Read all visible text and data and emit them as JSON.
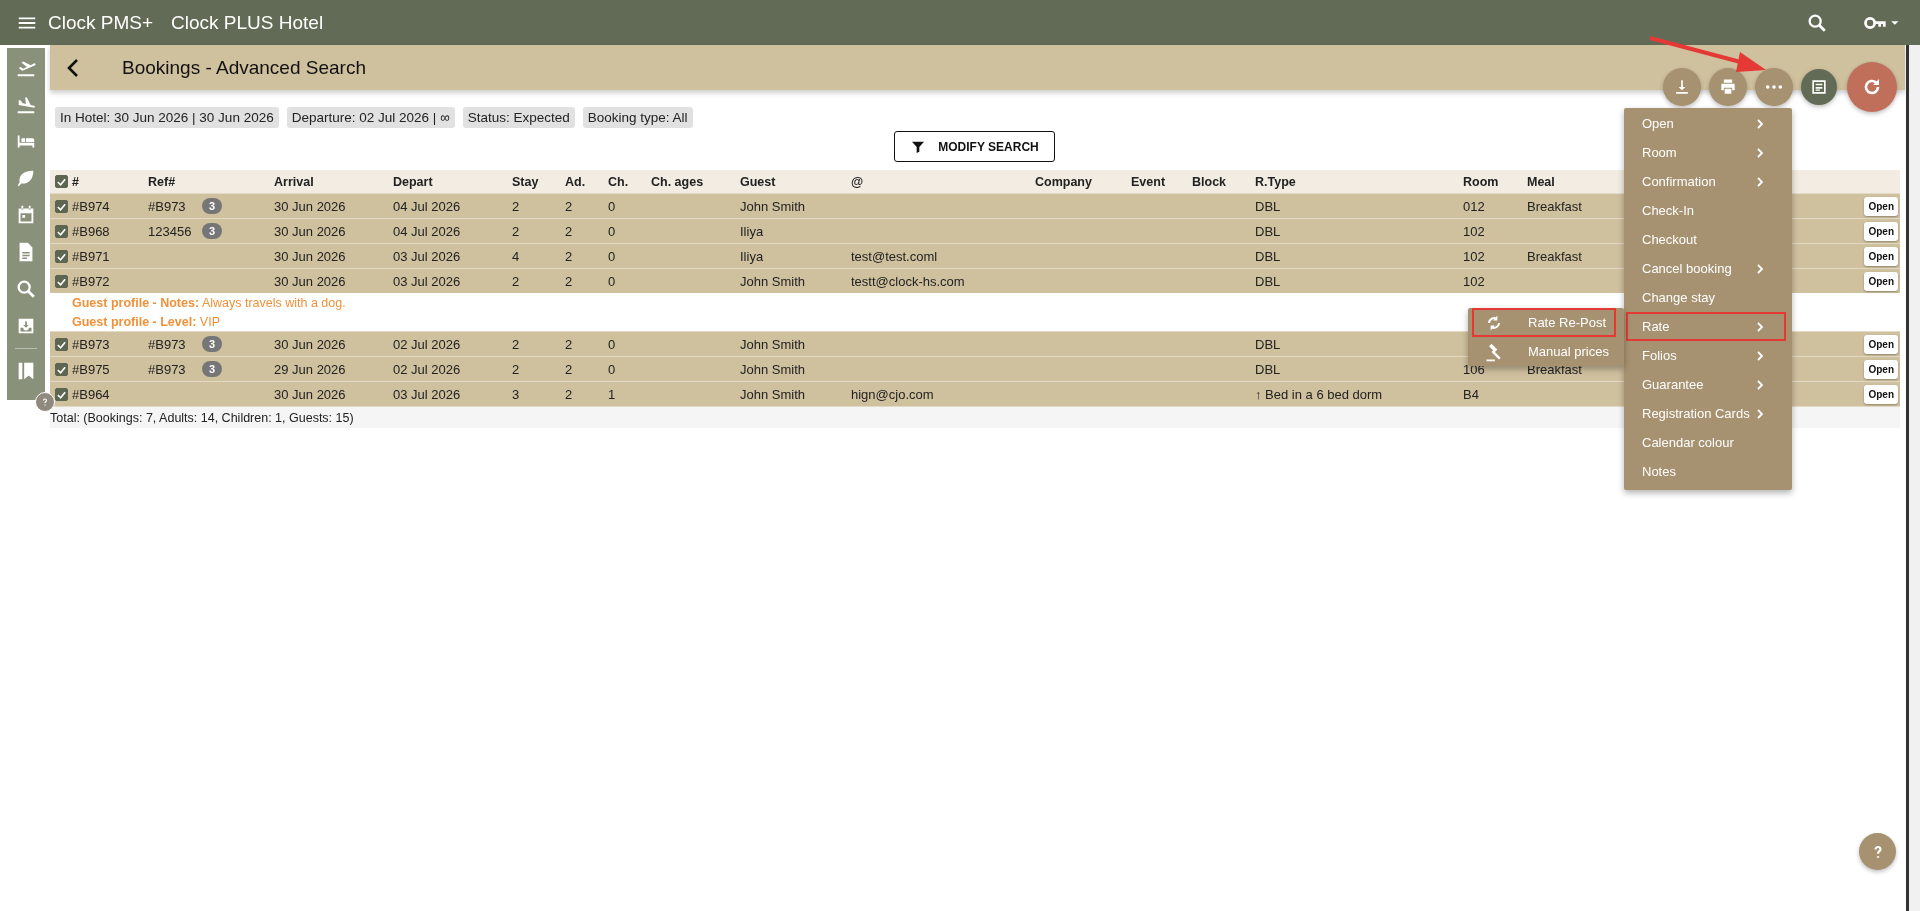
{
  "app_bar": {
    "product": "Clock PMS+",
    "hotel": "Clock PLUS Hotel"
  },
  "page_header": {
    "title": "Bookings - Advanced Search"
  },
  "filters": [
    "In Hotel: 30 Jun 2026 | 30 Jun 2026",
    "Departure: 02 Jul 2026 | ∞",
    "Status: Expected",
    "Booking type: All"
  ],
  "modify_button": "MODIFY SEARCH",
  "table": {
    "select_all": true,
    "columns": [
      "#",
      "Ref#",
      "Arrival",
      "Depart",
      "Stay",
      "Ad.",
      "Ch.",
      "Ch. ages",
      "Guest",
      "@",
      "Company",
      "Event",
      "Block",
      "R.Type",
      "Room",
      "Meal"
    ],
    "rows": [
      {
        "kind": "booking",
        "checked": true,
        "id": "#B974",
        "ref": "#B973",
        "ref_count": "3",
        "arrival": "30 Jun 2026",
        "depart": "04 Jul 2026",
        "stay": "2",
        "adults": "2",
        "children": "0",
        "guest": "John Smith",
        "email": "",
        "rtype": "DBL",
        "room": "012",
        "meal": "Breakfast",
        "action": "Open"
      },
      {
        "kind": "booking",
        "checked": true,
        "id": "#B968",
        "ref": "123456",
        "ref_count": "3",
        "arrival": "30 Jun 2026",
        "depart": "04 Jul 2026",
        "stay": "2",
        "adults": "2",
        "children": "0",
        "guest": "Iliya",
        "email": "",
        "rtype": "DBL",
        "room": "102",
        "meal": "",
        "action": "Open"
      },
      {
        "kind": "booking",
        "checked": true,
        "id": "#B971",
        "ref": "",
        "ref_count": "",
        "arrival": "30 Jun 2026",
        "depart": "03 Jul 2026",
        "stay": "4",
        "adults": "2",
        "children": "0",
        "guest": "Iliya",
        "email": "test@test.coml",
        "rtype": "DBL",
        "room": "102",
        "meal": "Breakfast",
        "action": "Open"
      },
      {
        "kind": "booking",
        "checked": true,
        "id": "#B972",
        "ref": "",
        "ref_count": "",
        "arrival": "30 Jun 2026",
        "depart": "03 Jul 2026",
        "stay": "2",
        "adults": "2",
        "children": "0",
        "guest": "John Smith",
        "email": "testt@clock-hs.com",
        "rtype": "DBL",
        "room": "102",
        "meal": "",
        "action": "Open"
      },
      {
        "kind": "note",
        "text": "**Guest profile - Notes:** Always travels with a dog."
      },
      {
        "kind": "note",
        "text": "**Guest profile - Level:** VIP"
      },
      {
        "kind": "booking",
        "checked": true,
        "id": "#B973",
        "ref": "#B973",
        "ref_count": "3",
        "arrival": "30 Jun 2026",
        "depart": "02 Jul 2026",
        "stay": "2",
        "adults": "2",
        "children": "0",
        "guest": "John Smith",
        "email": "",
        "rtype": "DBL",
        "room": "",
        "meal": "",
        "action": "Open"
      },
      {
        "kind": "booking",
        "checked": true,
        "id": "#B975",
        "ref": "#B973",
        "ref_count": "3",
        "arrival": "29 Jun 2026",
        "depart": "02 Jul 2026",
        "stay": "2",
        "adults": "2",
        "children": "0",
        "guest": "John Smith",
        "email": "",
        "rtype": "DBL",
        "room": "106",
        "meal": "Breakfast",
        "action": "Open"
      },
      {
        "kind": "booking",
        "checked": true,
        "id": "#B964",
        "ref": "",
        "ref_count": "",
        "arrival": "30 Jun 2026",
        "depart": "03 Jul 2026",
        "stay": "3",
        "adults": "2",
        "children": "1",
        "guest": "John Smith",
        "email": "hign@cjo.com",
        "rtype": "↑ Bed in a 6 bed dorm",
        "room": "B4",
        "meal": "",
        "action": "Open"
      }
    ],
    "total": "Total: (Bookings: 7, Adults: 14, Children: 1, Guests: 15)"
  },
  "context_menu": {
    "items": [
      {
        "label": "Open",
        "submenu": true,
        "highlighted": false
      },
      {
        "label": "Room",
        "submenu": true,
        "highlighted": false
      },
      {
        "label": "Confirmation",
        "submenu": true,
        "highlighted": false
      },
      {
        "label": "Check-In",
        "submenu": false,
        "highlighted": false
      },
      {
        "label": "Checkout",
        "submenu": false,
        "highlighted": false
      },
      {
        "label": "Cancel booking",
        "submenu": true,
        "highlighted": false
      },
      {
        "label": "Change stay",
        "submenu": false,
        "highlighted": false
      },
      {
        "label": "Rate",
        "submenu": true,
        "highlighted": true
      },
      {
        "label": "Folios",
        "submenu": true,
        "highlighted": false
      },
      {
        "label": "Guarantee",
        "submenu": true,
        "highlighted": false
      },
      {
        "label": "Registration Cards",
        "submenu": true,
        "highlighted": false
      },
      {
        "label": "Calendar colour",
        "submenu": false,
        "highlighted": false
      },
      {
        "label": "Notes",
        "submenu": false,
        "highlighted": false
      }
    ]
  },
  "submenu": {
    "items": [
      {
        "label": "Rate Re-Post",
        "highlighted": true
      },
      {
        "label": "Manual prices",
        "highlighted": false
      }
    ]
  }
}
